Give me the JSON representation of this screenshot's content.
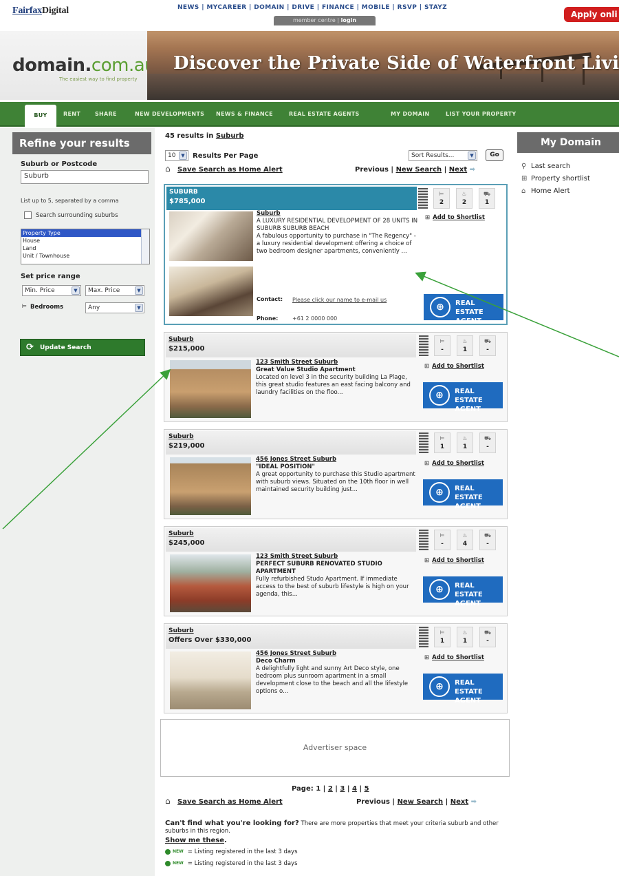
{
  "topbar": {
    "brand_a": "Fairfax",
    "brand_b": "Digital",
    "links": "NEWS | MYCAREER | DOMAIN | DRIVE | FINANCE | MOBILE | RSVP | STAYZ",
    "member_centre": "member centre |",
    "login": "login",
    "apply": "Apply onli"
  },
  "header": {
    "logo_main": "domain.",
    "logo_tld": "com.au",
    "tagline": "The easiest way to find property",
    "banner_text": "Discover the Private Side of Waterfront Living"
  },
  "nav": {
    "buy": "BUY",
    "rent": "RENT",
    "share": "SHARE",
    "new_dev": "NEW DEVELOPMENTS",
    "news_finance": "NEWS & FINANCE",
    "agents": "REAL ESTATE AGENTS",
    "my_domain": "MY DOMAIN",
    "list": "LIST YOUR PROPERTY"
  },
  "refine": {
    "title": "Refine your results",
    "suburb_label": "Suburb or Postcode",
    "suburb_value": "Suburb",
    "hint": "List up to 5, separated by a comma",
    "surrounding": "Search surrounding suburbs",
    "property_types": [
      "Property Type",
      "House",
      "Land",
      "Unit / Townhouse"
    ],
    "price_label": "Set price range",
    "min_price": "Min. Price",
    "max_price": "Max. Price",
    "bedrooms_label": "Bedrooms",
    "bedrooms_value": "Any",
    "update": "Update Search"
  },
  "results": {
    "count_text": "45 results in",
    "suburb_link": "Suburb",
    "per_page_value": "10",
    "per_page_label": "Results Per Page",
    "sort_value": "Sort Results...",
    "go": "Go",
    "save_alert": "Save Search as Home Alert",
    "previous": "Previous |",
    "new_search": "New Search",
    "sep": "|",
    "next": "Next"
  },
  "listings": [
    {
      "suburb": "SUBURB",
      "price": "$785,000",
      "beds": "2",
      "baths": "2",
      "cars": "1",
      "address": "Suburb",
      "title": "A LUXURY RESIDENTIAL DEVELOPMENT OF 28 UNITS IN SUBURB SUBURB BEACH",
      "description": "A fabulous opportunity to purchase in \"The Regency\" - a luxury residential development offering a choice of two bedroom designer apartments, conveniently ...",
      "contact_label": "Contact:",
      "contact_value": "Please click our name to e-mail us",
      "phone_label": "Phone:",
      "phone_value": "+61 2 0000 000",
      "shortlist": "Add to Shortlist",
      "agent": "REAL ESTATE AGENT"
    },
    {
      "suburb": "Suburb",
      "price": "$215,000",
      "beds": "-",
      "baths": "1",
      "cars": "-",
      "address": "123 Smith Street Suburb",
      "title": "Great Value Studio Apartment",
      "description": "Located on level 3 in the security building La Plage, this great studio features an east facing balcony and laundry facilities on the floo...",
      "shortlist": "Add to Shortlist",
      "agent": "REAL ESTATE AGENT"
    },
    {
      "suburb": "Suburb",
      "price": "$219,000",
      "beds": "1",
      "baths": "1",
      "cars": "-",
      "address": "456 Jones Street Suburb",
      "title": "\"IDEAL POSITION\"",
      "description": "A great opportunity to purchase this Studio apartment with suburb views. Situated on the 10th floor in well maintained security building just...",
      "shortlist": "Add to Shortlist",
      "agent": "REAL ESTATE AGENT"
    },
    {
      "suburb": "Suburb",
      "price": "$245,000",
      "beds": "-",
      "baths": "4",
      "cars": "-",
      "address": "123 Smith Street Suburb",
      "title": "PERFECT SUBURB RENOVATED STUDIO APARTMENT",
      "description": "Fully refurbished Studo Apartment. If immediate access to the best of suburb lifestyle is high on your agenda, this...",
      "shortlist": "Add to Shortlist",
      "agent": "REAL ESTATE AGENT"
    },
    {
      "suburb": "Suburb",
      "price": "Offers Over $330,000",
      "beds": "1",
      "baths": "1",
      "cars": "-",
      "address": "456 Jones Street Suburb",
      "title": "Deco Charm",
      "description": "A delightfully light and sunny Art Deco style, one bedroom plus sunroom apartment in a small development close to the beach and all the lifestyle options o...",
      "shortlist": "Add to Shortlist",
      "agent": "REAL ESTATE AGENT"
    }
  ],
  "advert": "Advertiser space",
  "footer": {
    "page_label": "Page:",
    "pages": [
      "1",
      "2",
      "3",
      "4",
      "5"
    ],
    "cant_find_bold": "Can't find what you're looking for?",
    "cant_find_rest": "There are more properties that meet your criteria suburb and other suburbs in this region.",
    "show_me": "Show me these",
    "legend_new": "NEW",
    "legend_text": "= Listing registered in the last 3 days"
  },
  "mydomain": {
    "title": "My Domain",
    "last_search": "Last search",
    "shortlist": "Property shortlist",
    "home_alert": "Home Alert"
  },
  "colors": {
    "nav_green": "#3f8236",
    "featured_blue": "#2b89a8",
    "agent_blue": "#1f6bbf",
    "annotation_green": "#3aa13a"
  }
}
